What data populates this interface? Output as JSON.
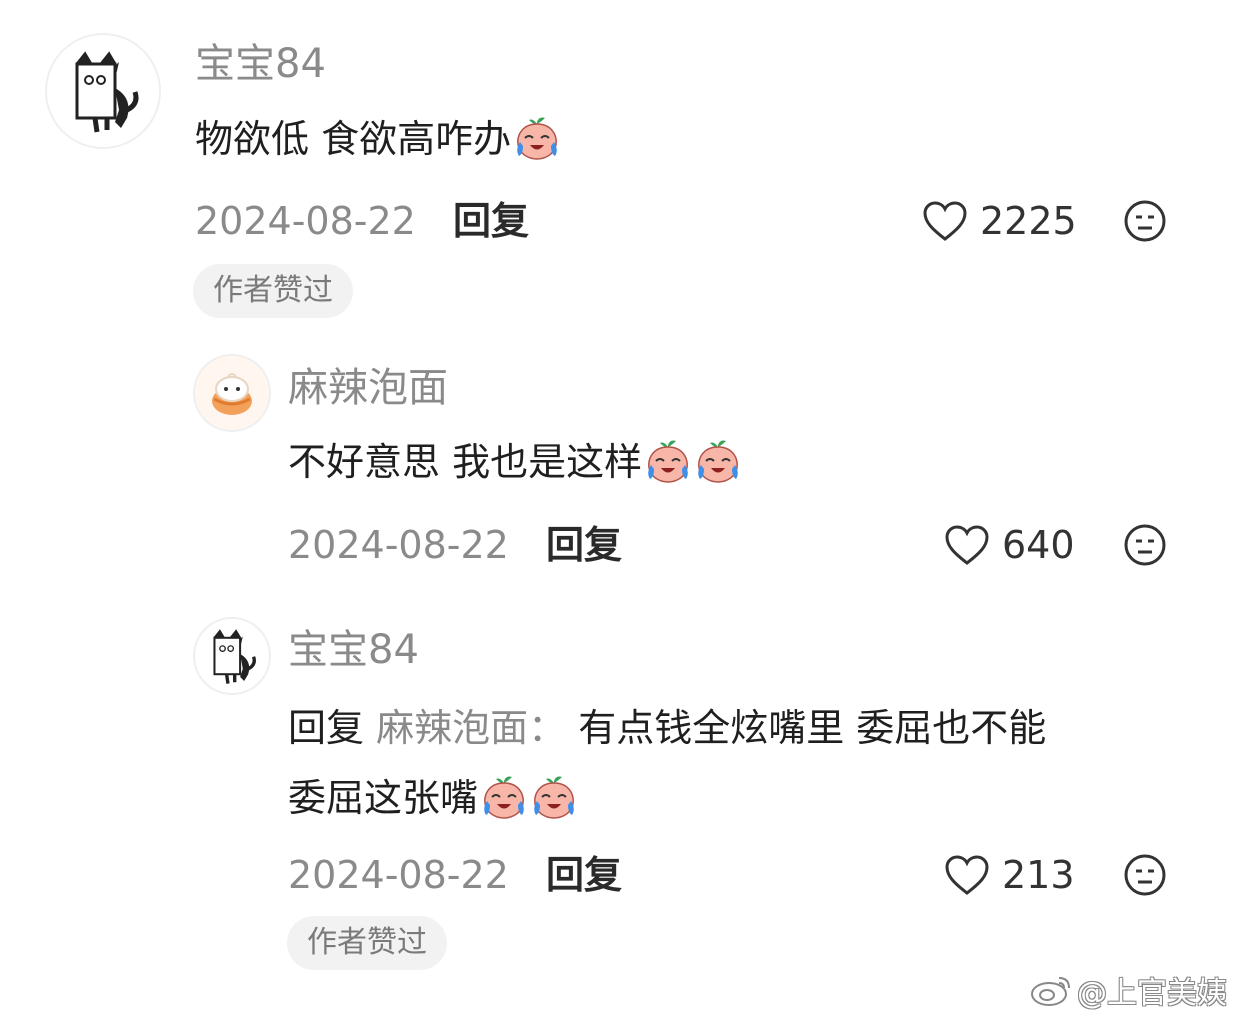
{
  "comments": [
    {
      "username": "宝宝84",
      "text": "物欲低 食欲高咋办",
      "emoji_icon": "crying-peach-emoji",
      "date": "2024-08-22",
      "reply_label": "回复",
      "likes": "2225",
      "badge": "作者赞过"
    },
    {
      "username": "麻辣泡面",
      "text": "不好意思 我也是这样",
      "emoji_icon": "crying-peach-emoji",
      "date": "2024-08-22",
      "reply_label": "回复",
      "likes": "640"
    },
    {
      "username": "宝宝84",
      "reply_prefix": "回复",
      "reply_target": "麻辣泡面：",
      "text_line1": "有点钱全炫嘴里 委屈也不能",
      "text_line2": "委屈这张嘴",
      "emoji_icon": "crying-peach-emoji",
      "date": "2024-08-22",
      "reply_label": "回复",
      "likes": "213",
      "badge": "作者赞过"
    }
  ],
  "watermark": {
    "icon": "weibo-logo-icon",
    "text": "@上官美姨"
  },
  "colors": {
    "username": "#8a8a8a",
    "text": "#1f1f1f",
    "badge_bg": "#f2f2f2"
  }
}
